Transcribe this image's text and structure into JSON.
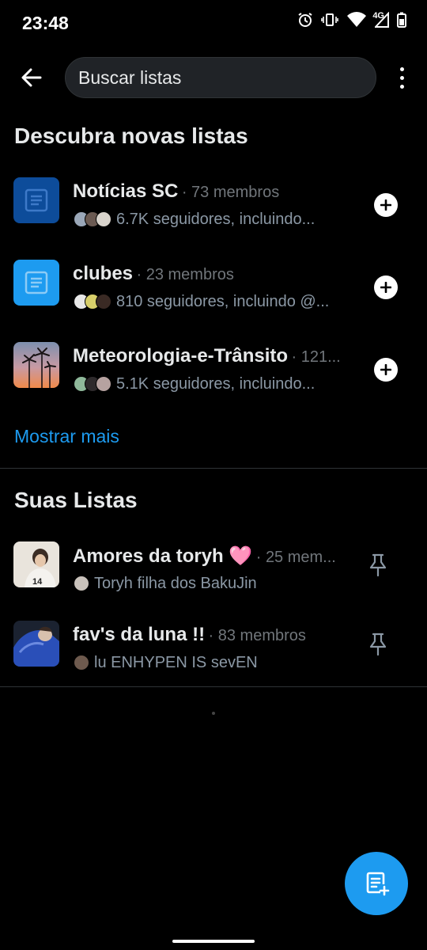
{
  "status": {
    "time": "23:48",
    "network": "4G"
  },
  "search": {
    "placeholder": "Buscar listas"
  },
  "discover": {
    "title": "Descubra novas listas",
    "items": [
      {
        "name": "Notícias SC",
        "members": "73 membros",
        "subtitle": "6.7K seguidores, incluindo...",
        "thumb": "doc-icon-dark-blue"
      },
      {
        "name": "clubes",
        "members": "23 membros",
        "subtitle": "810 seguidores, incluindo @...",
        "thumb": "doc-icon-light-blue"
      },
      {
        "name": "Meteorologia-e-Trânsito",
        "members": "121...",
        "subtitle": "5.1K seguidores, incluindo...",
        "thumb": "palm-sunset-photo"
      }
    ],
    "show_more": "Mostrar mais"
  },
  "yours": {
    "title": "Suas Listas",
    "items": [
      {
        "name": "Amores da toryh 🩷",
        "members": "25 mem...",
        "owner": "Toryh filha dos BakuJin",
        "thumb": "person-photo"
      },
      {
        "name": "fav's da luna !!",
        "members": "83 membros",
        "owner": "lu ENHYPEN IS sevEN",
        "thumb": "blue-jacket-photo"
      }
    ]
  },
  "colors": {
    "accent": "#1d9bf0",
    "background": "#000000",
    "secondary_text": "#71767b"
  },
  "icons": [
    "back-arrow-icon",
    "more-vertical-icon",
    "plus-icon",
    "pin-icon",
    "new-list-icon",
    "alarm-icon",
    "vibrate-icon",
    "wifi-icon",
    "signal-icon",
    "battery-icon"
  ]
}
